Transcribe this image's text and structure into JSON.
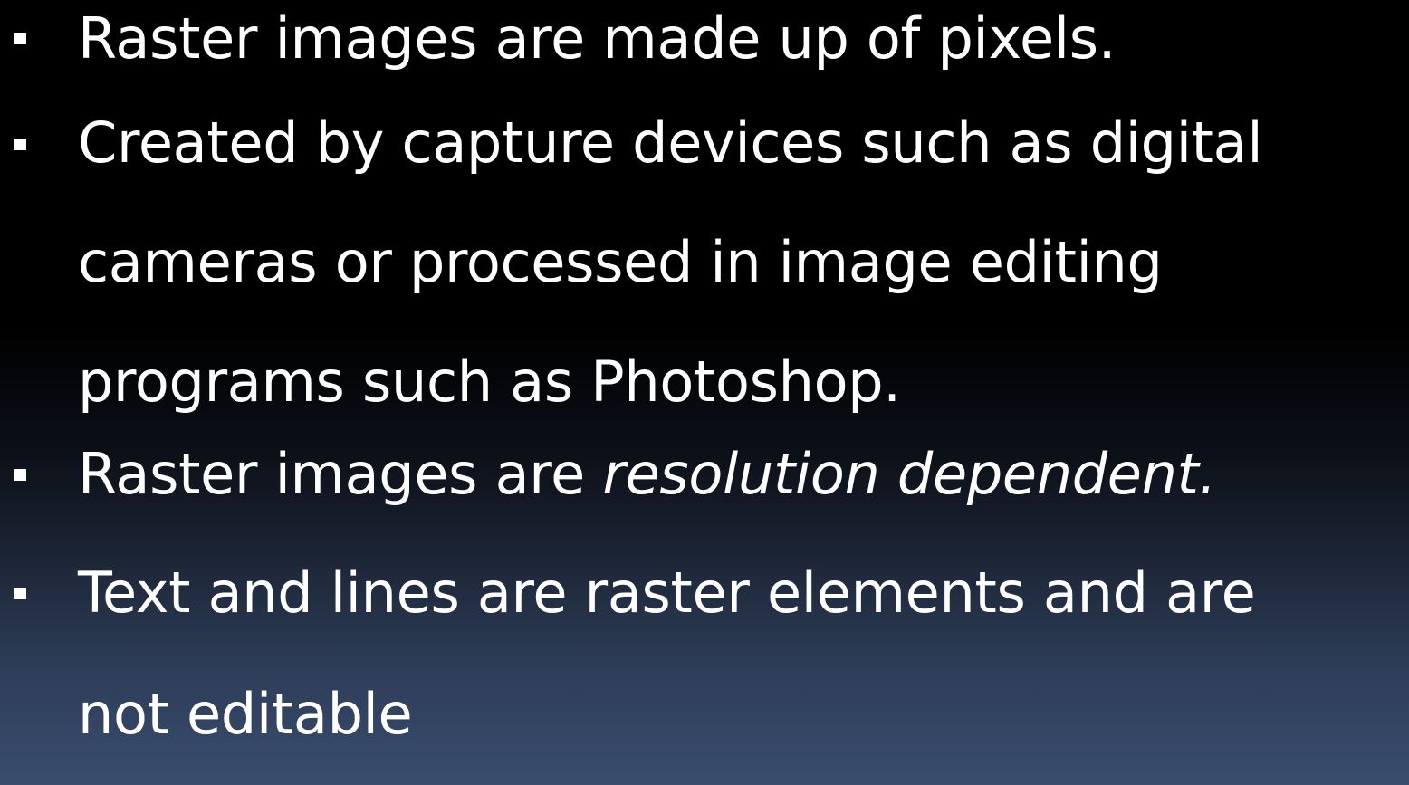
{
  "slide": {
    "bullets": [
      {
        "lines": [
          "Raster images are made up of pixels."
        ]
      },
      {
        "lines": [
          "Created by capture devices such as digital",
          "cameras or processed in image editing",
          "programs such as Photoshop."
        ]
      },
      {
        "normal": "Raster images are ",
        "italic": "resolution dependent."
      },
      {
        "lines": [
          "Text and lines are raster elements and are",
          "not editable"
        ]
      }
    ]
  },
  "colors": {
    "text": "#ffffff",
    "background_top": "#000000",
    "background_bottom": "#3a4d6e"
  }
}
